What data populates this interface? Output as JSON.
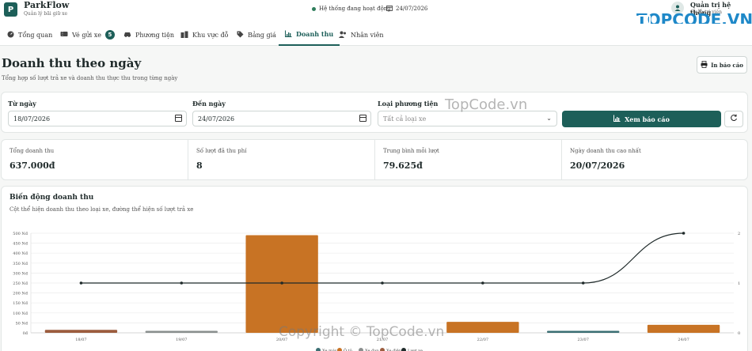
{
  "header": {
    "brand_name": "ParkFlow",
    "brand_sub": "Quản lý bãi giữ xe",
    "brand_letter": "P",
    "status_text": "Hệ thống đang hoạt động",
    "date_text": "24/07/2026",
    "user_name": "Quản trị hệ thống",
    "user_role": "Quản trị viên"
  },
  "nav": {
    "items": [
      {
        "label": "Tổng quan",
        "icon": "gauge-icon"
      },
      {
        "label": "Vé gửi xe",
        "icon": "ticket-icon",
        "badge": "5"
      },
      {
        "label": "Phương tiện",
        "icon": "car-icon"
      },
      {
        "label": "Khu vực đỗ",
        "icon": "building-icon"
      },
      {
        "label": "Bảng giá",
        "icon": "tag-icon"
      },
      {
        "label": "Doanh thu",
        "icon": "chart-icon",
        "active": true
      },
      {
        "label": "Nhân viên",
        "icon": "users-icon"
      }
    ]
  },
  "page": {
    "title": "Doanh thu theo ngày",
    "subtitle": "Tổng hợp số lượt trả xe và doanh thu thực thu trong từng ngày",
    "print_label": "In báo cáo"
  },
  "filters": {
    "from_label": "Từ ngày",
    "from_value": "18/07/2026",
    "to_label": "Đến ngày",
    "to_value": "24/07/2026",
    "type_label": "Loại phương tiện",
    "type_value": "Tất cả loại xe",
    "view_label": "Xem báo cáo"
  },
  "stats": [
    {
      "label": "Tổng doanh thu",
      "value": "637.000đ"
    },
    {
      "label": "Số lượt đã thu phí",
      "value": "8"
    },
    {
      "label": "Trung bình mỗi lượt",
      "value": "79.625đ"
    },
    {
      "label": "Ngày doanh thu cao nhất",
      "value": "20/07/2026"
    }
  ],
  "chart_card": {
    "title": "Biến động doanh thu",
    "subtitle": "Cột thể hiện doanh thu theo loại xe, đường thể hiện số lượt trả xe"
  },
  "watermark": {
    "logo_text": "TOPCODE.VN",
    "mid_text": "TopCode.vn",
    "bottom_text": "Copyright © TopCode.vn"
  },
  "colors": {
    "primary": "#1d5f59",
    "bar_main": "#c87324",
    "bar_brown": "#9c5c3e",
    "bar_teal": "#3b6f73",
    "line": "#1f2a2a"
  },
  "chart_data": {
    "type": "bar",
    "categories": [
      "18/07",
      "19/07",
      "20/07",
      "21/07",
      "22/07",
      "23/07",
      "24/07"
    ],
    "y_ticks": [
      "0đ",
      "50 Nđ",
      "100 Nđ",
      "150 Nđ",
      "200 Nđ",
      "250 Nđ",
      "300 Nđ",
      "350 Nđ",
      "400 Nđ",
      "450 Nđ",
      "500 Nđ"
    ],
    "y2_ticks": [
      "0",
      "1",
      "2"
    ],
    "ylim": [
      0,
      500000
    ],
    "y2lim": [
      0,
      2
    ],
    "series": [
      {
        "name": "Xe máy",
        "color": "#3b6f73",
        "values": [
          0,
          0,
          0,
          0,
          0,
          5000,
          0
        ]
      },
      {
        "name": "Ô tô",
        "color": "#c87324",
        "values": [
          0,
          0,
          490000,
          0,
          55000,
          0,
          40000
        ]
      },
      {
        "name": "Xe đạp",
        "color": "#8a8f8e",
        "values": [
          0,
          2000,
          0,
          0,
          0,
          0,
          0
        ]
      },
      {
        "name": "Xe điện",
        "color": "#9c5c3e",
        "values": [
          15000,
          0,
          0,
          0,
          0,
          0,
          0
        ]
      }
    ],
    "line_series": {
      "name": "Lượt xe",
      "color": "#1f2a2a",
      "values": [
        1,
        1,
        1,
        1,
        1,
        1,
        2
      ]
    }
  }
}
